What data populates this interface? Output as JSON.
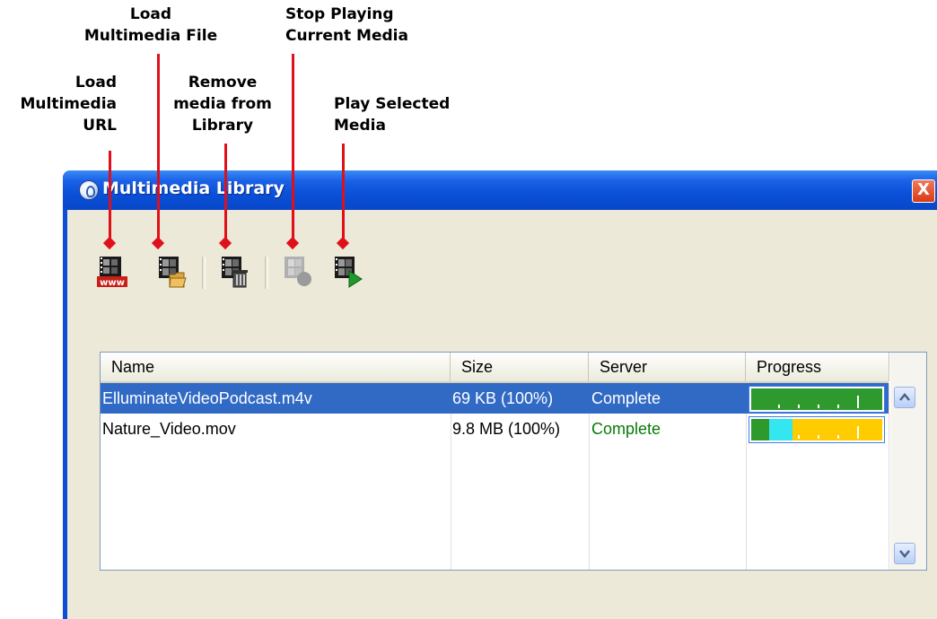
{
  "annotations": {
    "load_url": [
      "Load",
      "Multimedia",
      "URL"
    ],
    "load_file": [
      "Load",
      "Multimedia File"
    ],
    "remove": [
      "Remove",
      "media from",
      "Library"
    ],
    "stop": [
      "Stop Playing",
      "Current Media"
    ],
    "play": [
      "Play Selected",
      "Media"
    ]
  },
  "window": {
    "title": "Multimedia Library",
    "close_label": "X"
  },
  "toolbar": {
    "buttons": [
      {
        "name": "load-url-button",
        "icon": "film-www-icon"
      },
      {
        "name": "load-file-button",
        "icon": "film-folder-icon"
      },
      {
        "name": "remove-media-button",
        "icon": "film-trash-icon"
      },
      {
        "name": "stop-button",
        "icon": "film-stop-icon",
        "disabled": true
      },
      {
        "name": "play-button",
        "icon": "film-play-icon"
      }
    ]
  },
  "table": {
    "columns": [
      "Name",
      "Size",
      "Server",
      "Progress"
    ],
    "rows": [
      {
        "name": "ElluminateVideoPodcast.m4v",
        "size": "69 KB (100%)",
        "server": "Complete",
        "progress": 1.0,
        "selected": true
      },
      {
        "name": "Nature_Video.mov",
        "size": "9.8 MB (100%)",
        "server": "Complete",
        "progress": 1.0,
        "selected": false
      }
    ]
  },
  "colors": {
    "selection": "#316ac5",
    "progress_green": "#2e9a2e",
    "progress_cyan": "#33e6f0",
    "progress_yellow": "#ffcc00",
    "status_complete": "#087a08",
    "arrow_red": "#e0101a"
  }
}
